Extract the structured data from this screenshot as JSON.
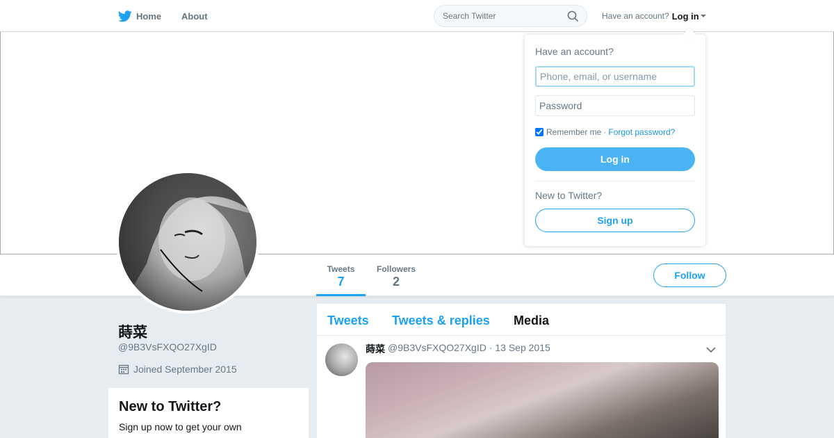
{
  "topbar": {
    "home_label": "Home",
    "about_label": "About",
    "search_placeholder": "Search Twitter",
    "have_account": "Have an account?",
    "login_label": "Log in"
  },
  "profile": {
    "name": "蒔菜",
    "handle": "@9B3VsFXQO27XgID",
    "joined": "Joined September 2015",
    "stats": {
      "tweets_label": "Tweets",
      "tweets_value": "7",
      "followers_label": "Followers",
      "followers_value": "2"
    },
    "follow_label": "Follow"
  },
  "new_card": {
    "title": "New to Twitter?",
    "text": "Sign up now to get your own"
  },
  "timeline": {
    "tabs": [
      "Tweets",
      "Tweets & replies",
      "Media"
    ],
    "tweet": {
      "name": "蒔菜",
      "handle": "@9B3VsFXQO27XgID",
      "date": "· 13 Sep 2015"
    }
  },
  "login_dropdown": {
    "title": "Have an account?",
    "username_placeholder": "Phone, email, or username",
    "password_placeholder": "Password",
    "remember_label": "Remember me",
    "separator": "·",
    "forgot_label": "Forgot password?",
    "login_button": "Log in",
    "new_to_twitter": "New to Twitter?",
    "signup_button": "Sign up"
  },
  "colors": {
    "accent": "#1da1f2",
    "button_blue": "#4ab3f4",
    "page_bg": "#e6ecf0",
    "muted_text": "#657786"
  },
  "icons": [
    "twitter-bird-icon",
    "search-icon",
    "caret-down-icon",
    "calendar-icon",
    "chevron-down-icon"
  ]
}
